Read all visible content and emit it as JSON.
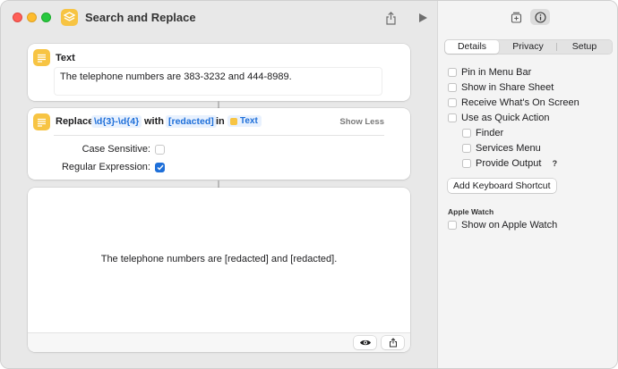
{
  "window": {
    "title": "Search and Replace"
  },
  "colors": {
    "accent": "#1e6fd9",
    "action_icon": "#f7c443"
  },
  "actions": {
    "text_action": {
      "title": "Text",
      "content": "The telephone numbers are 383-3232 and 444-8989."
    },
    "replace_action": {
      "title": "Replace",
      "pattern": "\\d{3}-\\d{4}",
      "with_label": "with",
      "replacement": "[redacted]",
      "in_label": "in",
      "variable": "Text",
      "show_less": "Show Less",
      "case_sensitive_label": "Case Sensitive:",
      "case_sensitive": false,
      "regex_label": "Regular Expression:",
      "regex": true
    },
    "output": {
      "text": "The telephone numbers are [redacted] and [redacted]."
    }
  },
  "inspector": {
    "tabs": [
      {
        "label": "Details",
        "active": true
      },
      {
        "label": "Privacy",
        "active": false
      },
      {
        "label": "Setup",
        "active": false
      }
    ],
    "options": [
      {
        "label": "Pin in Menu Bar",
        "checked": false
      },
      {
        "label": "Show in Share Sheet",
        "checked": false
      },
      {
        "label": "Receive What's On Screen",
        "checked": false
      },
      {
        "label": "Use as Quick Action",
        "checked": false
      }
    ],
    "quick_action_suboptions": [
      {
        "label": "Finder",
        "checked": false
      },
      {
        "label": "Services Menu",
        "checked": false
      },
      {
        "label": "Provide Output",
        "checked": false
      }
    ],
    "help_glyph": "?",
    "keyboard_shortcut_button": "Add Keyboard Shortcut",
    "apple_watch_heading": "Apple Watch",
    "apple_watch_option": {
      "label": "Show on Apple Watch",
      "checked": false
    }
  }
}
